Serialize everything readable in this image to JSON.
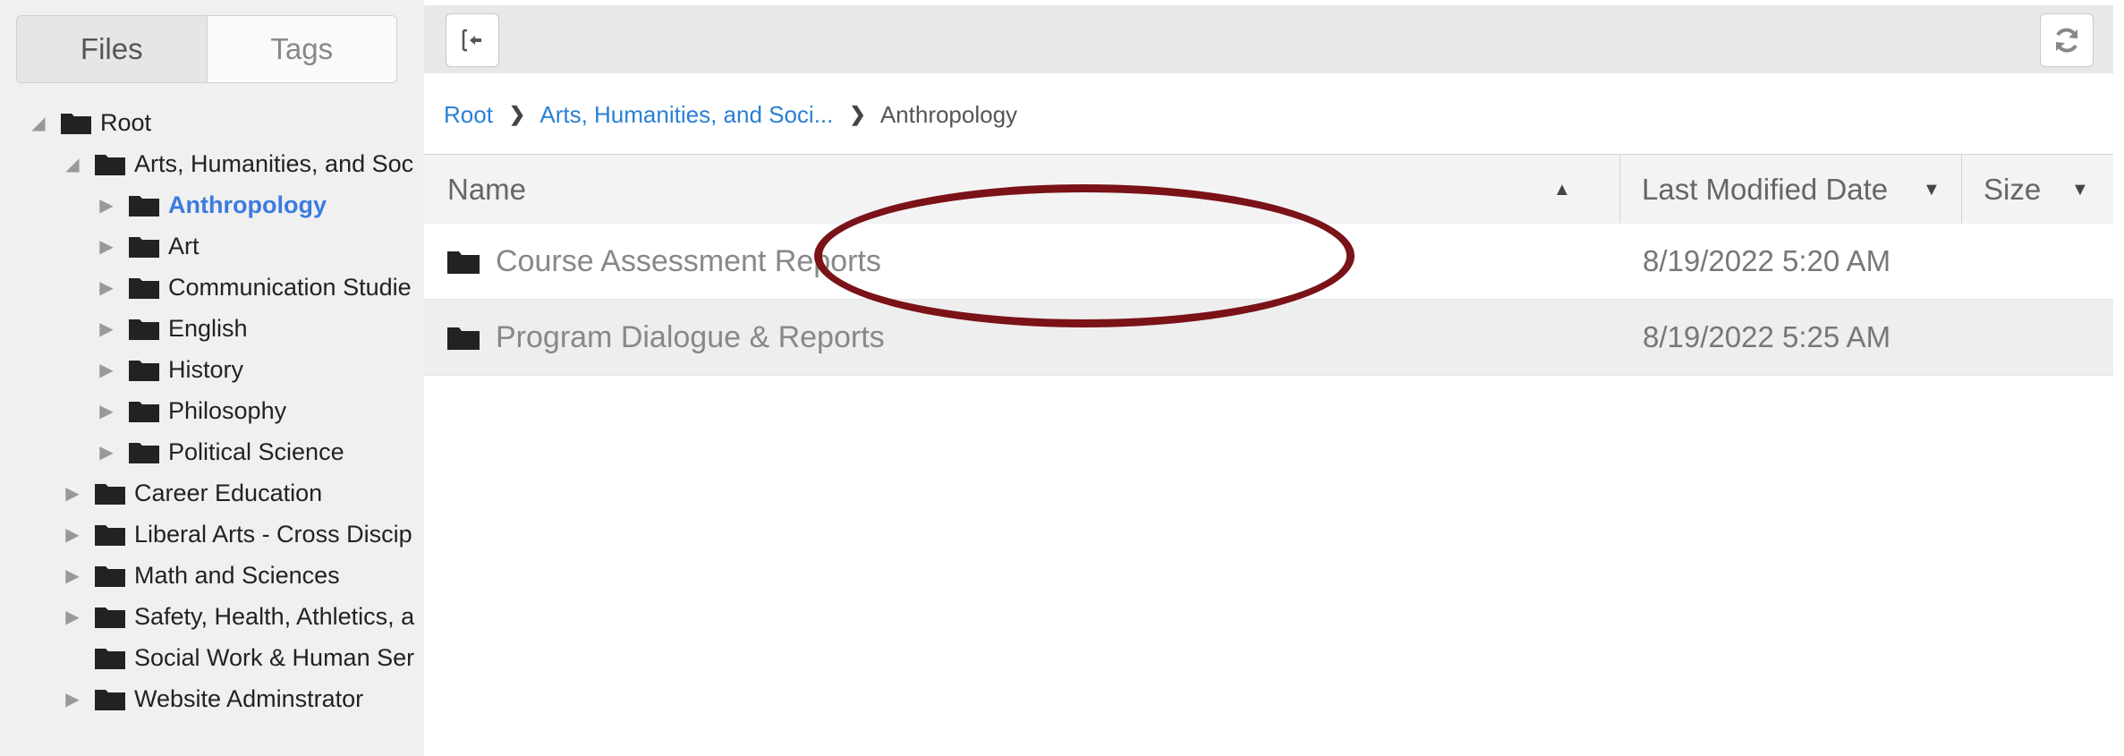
{
  "sidebar": {
    "tabs": [
      {
        "label": "Files"
      },
      {
        "label": "Tags"
      }
    ],
    "tree": [
      {
        "label": "Root",
        "depth": 0,
        "arrow": "open"
      },
      {
        "label": "Arts, Humanities, and Soc",
        "depth": 1,
        "arrow": "open"
      },
      {
        "label": "Anthropology",
        "depth": 2,
        "arrow": "closed",
        "selected": true
      },
      {
        "label": "Art",
        "depth": 2,
        "arrow": "closed"
      },
      {
        "label": "Communication Studie",
        "depth": 2,
        "arrow": "closed"
      },
      {
        "label": "English",
        "depth": 2,
        "arrow": "closed"
      },
      {
        "label": "History",
        "depth": 2,
        "arrow": "closed"
      },
      {
        "label": "Philosophy",
        "depth": 2,
        "arrow": "closed"
      },
      {
        "label": "Political Science",
        "depth": 2,
        "arrow": "closed"
      },
      {
        "label": "Career Education",
        "depth": 1,
        "arrow": "closed"
      },
      {
        "label": "Liberal Arts - Cross Discip",
        "depth": 1,
        "arrow": "closed"
      },
      {
        "label": "Math and Sciences",
        "depth": 1,
        "arrow": "closed"
      },
      {
        "label": "Safety, Health, Athletics, a",
        "depth": 1,
        "arrow": "closed"
      },
      {
        "label": "Social Work & Human Ser",
        "depth": 1,
        "arrow": "none"
      },
      {
        "label": "Website Adminstrator",
        "depth": 1,
        "arrow": "closed"
      }
    ]
  },
  "toolbar": {
    "collapse_icon": "collapse-panel-icon",
    "refresh_icon": "refresh-icon"
  },
  "breadcrumb": {
    "items": [
      {
        "label": "Root",
        "link": true
      },
      {
        "label": "Arts, Humanities, and Soci...",
        "link": true
      },
      {
        "label": "Anthropology",
        "link": false
      }
    ]
  },
  "grid": {
    "columns": {
      "name": "Name",
      "date": "Last Modified Date",
      "size": "Size"
    },
    "rows": [
      {
        "name": "Course Assessment Reports",
        "date": "8/19/2022 5:20 AM",
        "size": ""
      },
      {
        "name": "Program Dialogue & Reports",
        "date": "8/19/2022 5:25 AM",
        "size": ""
      }
    ]
  },
  "colors": {
    "link": "#2a7fd4",
    "selected": "#3b7be0",
    "annotation": "#7a1218",
    "folder": "#222222"
  }
}
